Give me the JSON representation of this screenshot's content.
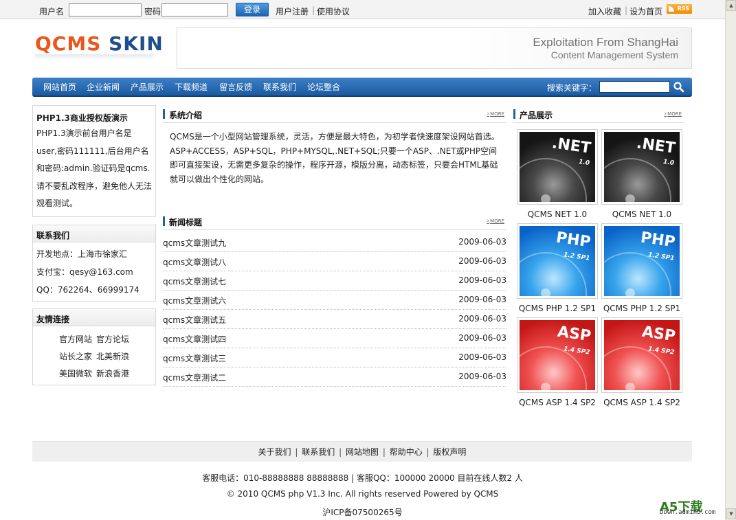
{
  "topbar": {
    "username_label": "用户名",
    "password_label": "密码",
    "login_button": "登录",
    "register_link": "用户注册",
    "separator": "|",
    "agreement_link": "使用协议",
    "favorite_link": "加入收藏",
    "homepage_link": "设为首页",
    "rss_label": "RSS"
  },
  "header": {
    "logo_part1": "QCMS",
    "logo_part2": "SKIN",
    "banner_line1": "Exploitation From ShangHai",
    "banner_line2": "Content Management System"
  },
  "nav": {
    "items": [
      "网站首页",
      "企业新闻",
      "产品展示",
      "下载频道",
      "留言反馈",
      "联系我们",
      "论坛整合"
    ],
    "search_label": "搜索关键字："
  },
  "sidebar": {
    "demo": {
      "title": "PHP1.3商业授权版演示",
      "body": "PHP1.3演示前台用户名是user,密码111111,后台用户名和密码:admin.验证码是qcms.请不要乱改程序，避免他人无法观看测试。"
    },
    "contact": {
      "title": "联系我们",
      "lines": [
        "开发地点：上海市徐家汇",
        "支付宝：qesy@163.com",
        "QQ：762264、66999174"
      ]
    },
    "links": {
      "title": "友情连接",
      "items": [
        "官方网站",
        "官方论坛",
        "站长之家",
        "北美新浪",
        "美国微软",
        "新浪香港"
      ]
    }
  },
  "main": {
    "intro": {
      "title": "系统介绍",
      "more": "MORE",
      "text": "QCMS是一个小型网站管理系统，灵活，方便是最大特色，为初学者快速度架设网站首选。ASP+ACCESS，ASP+SQL，PHP+MYSQL,.NET+SQL;只要一个ASP、.NET或PHP空间即可直接架设，无需更多复杂的操作，程序开源，模版分离，动态标签，只要会HTML基础就可以做出个性化的网站。"
    },
    "news": {
      "title": "新闻标题",
      "more": "MORE",
      "items": [
        {
          "title": "qcms文章测试九",
          "date": "2009-06-03"
        },
        {
          "title": "qcms文章测试八",
          "date": "2009-06-03"
        },
        {
          "title": "qcms文章测试七",
          "date": "2009-06-03"
        },
        {
          "title": "qcms文章测试六",
          "date": "2009-06-03"
        },
        {
          "title": "qcms文章测试五",
          "date": "2009-06-03"
        },
        {
          "title": "qcms文章测试四",
          "date": "2009-06-03"
        },
        {
          "title": "qcms文章测试三",
          "date": "2009-06-03"
        },
        {
          "title": "qcms文章测试二",
          "date": "2009-06-03"
        }
      ]
    }
  },
  "products": {
    "title": "产品展示",
    "more": "MORE",
    "items": [
      {
        "name": "QCMS NET 1.0",
        "label": ".NET",
        "version": "1.0",
        "theme": "net"
      },
      {
        "name": "QCMS NET 1.0",
        "label": ".NET",
        "version": "1.0",
        "theme": "net"
      },
      {
        "name": "QCMS PHP 1.2 SP1",
        "label": "PHP",
        "version": "1.2 SP1",
        "theme": "php"
      },
      {
        "name": "QCMS PHP 1.2 SP1",
        "label": "PHP",
        "version": "1.2 SP1",
        "theme": "php"
      },
      {
        "name": "QCMS ASP 1.4 SP2",
        "label": "ASP",
        "version": "1.4 SP2",
        "theme": "asp"
      },
      {
        "name": "QCMS ASP 1.4 SP2",
        "label": "ASP",
        "version": "1.4 SP2",
        "theme": "asp"
      }
    ]
  },
  "footer": {
    "links": [
      "关于我们",
      "联系我们",
      "网站地图",
      "帮助中心",
      "版权声明"
    ],
    "separator": "|",
    "service_line": "客服电话：010-88888888 88888888 | 客服QQ：100000 20000 目前在线人数2 人",
    "copyright": "© 2010 QCMS php V1.3 Inc. All rights reserved Powered by QCMS",
    "icp": "沪ICP备07500265号"
  },
  "watermark": {
    "brand": "A5下载",
    "domain": "Down.admin5.com"
  },
  "colors": {
    "nav_blue": "#1a5aa2",
    "logo_orange": "#e9561e",
    "logo_blue": "#1e4f8c"
  }
}
